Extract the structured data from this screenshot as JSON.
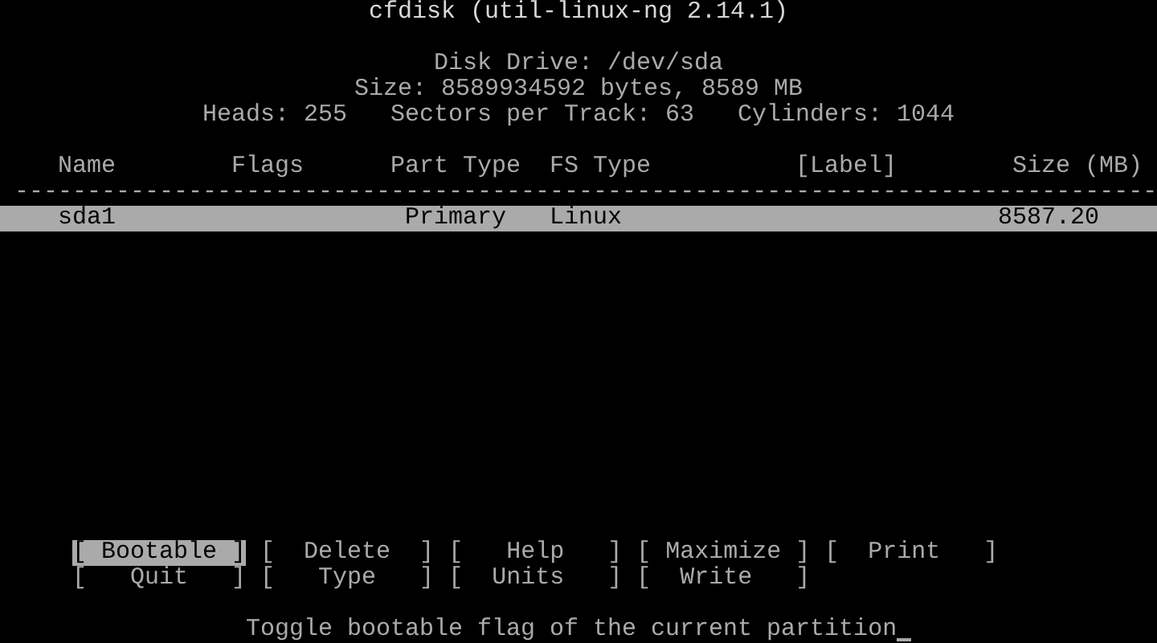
{
  "title": "cfdisk (util-linux-ng 2.14.1)",
  "disk_info": [
    "Disk Drive: /dev/sda",
    "Size: 8589934592 bytes, 8589 MB",
    "Heads: 255   Sectors per Track: 63   Cylinders: 1044"
  ],
  "table": {
    "columns": [
      "Name",
      "Flags",
      "Part Type",
      "FS Type",
      "[Label]",
      "Size (MB)"
    ],
    "separator": "-------------------------------------------------------------------------------",
    "rows": [
      {
        "name": "sda1",
        "part_type": "Primary",
        "fs_type": "Linux",
        "size": "8587.20",
        "selected": true
      }
    ]
  },
  "buttons": [
    [
      {
        "label": "[ Bootable ]",
        "selected": true
      },
      {
        "label": "[  Delete  ]",
        "selected": false
      },
      {
        "label": "[   Help   ]",
        "selected": false
      },
      {
        "label": "[ Maximize ]",
        "selected": false
      },
      {
        "label": "[  Print   ]",
        "selected": false
      }
    ],
    [
      {
        "label": "[   Quit   ]",
        "selected": false
      },
      {
        "label": "[   Type   ]",
        "selected": false
      },
      {
        "label": "[  Units   ]",
        "selected": false
      },
      {
        "label": "[  Write   ]",
        "selected": false
      }
    ]
  ],
  "message": "Toggle bootable flag of the current partition"
}
